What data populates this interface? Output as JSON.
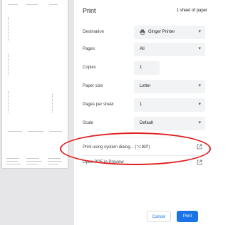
{
  "header": {
    "title": "Print",
    "sheets": "1 sheet of paper"
  },
  "settings": [
    {
      "label": "Destination",
      "value": "Ginger Printer",
      "icon": "printer-icon",
      "dropdown": true
    },
    {
      "label": "Pages",
      "value": "All",
      "dropdown": true
    },
    {
      "label": "Copies",
      "value": "1",
      "dropdown": false
    },
    {
      "label": "Paper size",
      "value": "Letter",
      "dropdown": true
    },
    {
      "label": "Pages per sheet",
      "value": "1",
      "dropdown": true
    },
    {
      "label": "Scale",
      "value": "Default",
      "dropdown": true
    }
  ],
  "links": {
    "system_dialog": "Print using system dialog... (⌥⌘P)",
    "open_pdf": "Open PDF in Preview"
  },
  "buttons": {
    "cancel": "Cancel",
    "print": "Print"
  },
  "colors": {
    "accent": "#1a73e8",
    "highlight": "#e02020"
  }
}
